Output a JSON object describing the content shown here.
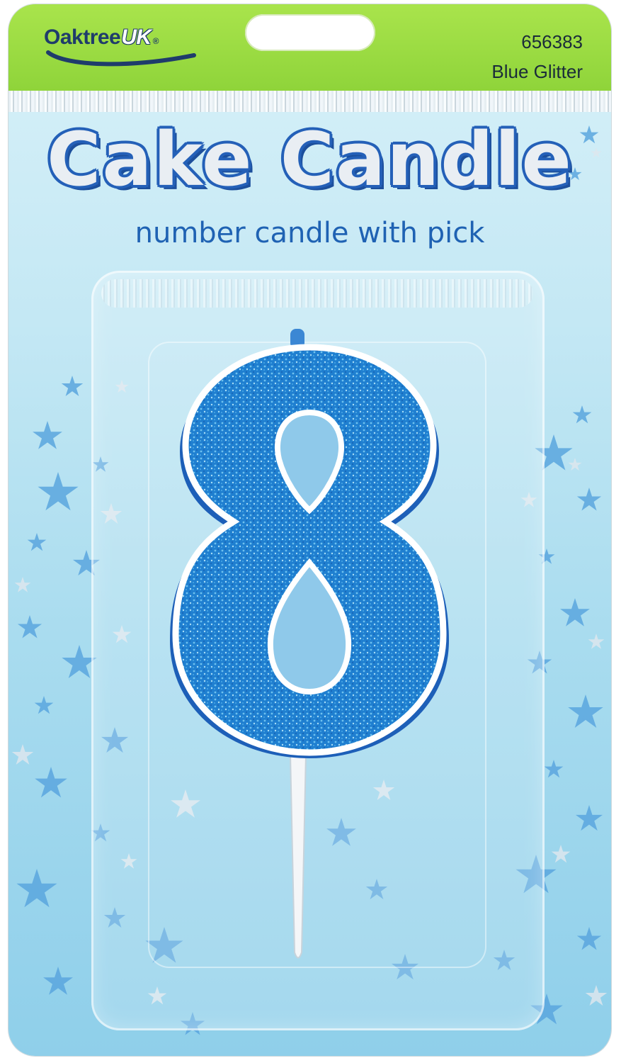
{
  "brand": {
    "name": "Oaktree",
    "suffix": "UK",
    "registered": "®"
  },
  "product": {
    "code": "656383",
    "variant": "Blue Glitter"
  },
  "headline": "Cake Candle",
  "subtitle": "number candle with pick",
  "candle_numeral": "8",
  "colors": {
    "header_green": "#98d840",
    "card_blue": "#a9dcef",
    "headline_outline": "#2460b8",
    "subtitle_blue": "#1f62b3",
    "glitter_blue": "#1f7fd0",
    "brand_navy": "#1f3c6b"
  }
}
